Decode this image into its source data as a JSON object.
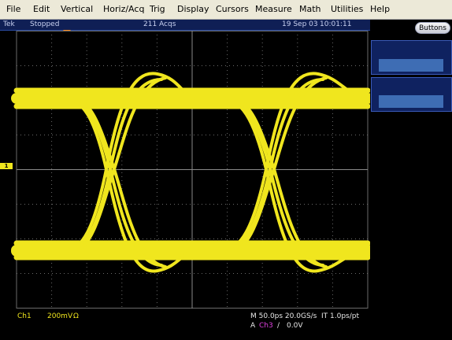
{
  "menu": [
    "File",
    "Edit",
    "Vertical",
    "Horiz/Acq",
    "Trig",
    "Display",
    "Cursors",
    "Measure",
    "Math",
    "Utilities",
    "Help"
  ],
  "status": {
    "brand": "Tek",
    "state": "Stopped",
    "acqs": "211 Acqs",
    "date": "19 Sep 03",
    "time": "10:01:11"
  },
  "right_panel": {
    "buttons_label": "Buttons"
  },
  "markers": {
    "channel": "1"
  },
  "readout": {
    "ch_label": "Ch1",
    "ch_scale": "200mV",
    "ch_impedance": "Ω",
    "timebase": "M 50.0ps 20.0GS/s",
    "resolution": "IT 1.0ps/pt",
    "trig_prefix": "A",
    "trig_source": "Ch3",
    "trig_slope": "/",
    "trig_level": "0.0V"
  },
  "colors": {
    "trace": "#f0e61e",
    "grid": "#6a6a6a",
    "trigger_marker": "#ff8c1a",
    "trigger_source": "#e040e0"
  }
}
